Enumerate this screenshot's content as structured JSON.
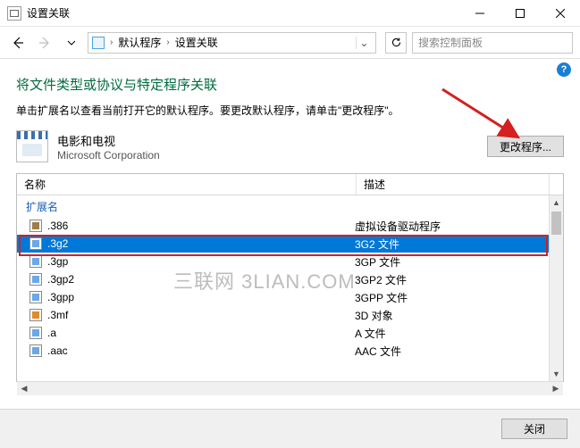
{
  "window": {
    "title": "设置关联",
    "minimize": "—",
    "maximize": "□",
    "close": "✕"
  },
  "nav": {
    "back": "←",
    "forward": "→",
    "breadcrumb": {
      "root": "默认程序",
      "current": "设置关联"
    },
    "refresh": "↻",
    "search_placeholder": "搜索控制面板"
  },
  "help": "?",
  "page": {
    "heading": "将文件类型或协议与特定程序关联",
    "subtext": "单击扩展名以查看当前打开它的默认程序。要更改默认程序，请单击\"更改程序\"。",
    "app": {
      "name": "电影和电视",
      "publisher": "Microsoft Corporation"
    },
    "change_button": "更改程序..."
  },
  "list": {
    "columns": {
      "name": "名称",
      "desc": "描述"
    },
    "group": "扩展名",
    "selected_index": 1,
    "items": [
      {
        "ext": ".386",
        "desc": "虚拟设备驱动程序",
        "iconClass": "alt"
      },
      {
        "ext": ".3g2",
        "desc": "3G2 文件",
        "iconClass": ""
      },
      {
        "ext": ".3gp",
        "desc": "3GP 文件",
        "iconClass": ""
      },
      {
        "ext": ".3gp2",
        "desc": "3GP2 文件",
        "iconClass": ""
      },
      {
        "ext": ".3gpp",
        "desc": "3GPP 文件",
        "iconClass": ""
      },
      {
        "ext": ".3mf",
        "desc": "3D 对象",
        "iconClass": "mf"
      },
      {
        "ext": ".a",
        "desc": "A 文件",
        "iconClass": ""
      },
      {
        "ext": ".aac",
        "desc": "AAC 文件",
        "iconClass": ""
      }
    ]
  },
  "footer": {
    "close": "关闭"
  },
  "watermark": "三联网 3LIAN.COM"
}
